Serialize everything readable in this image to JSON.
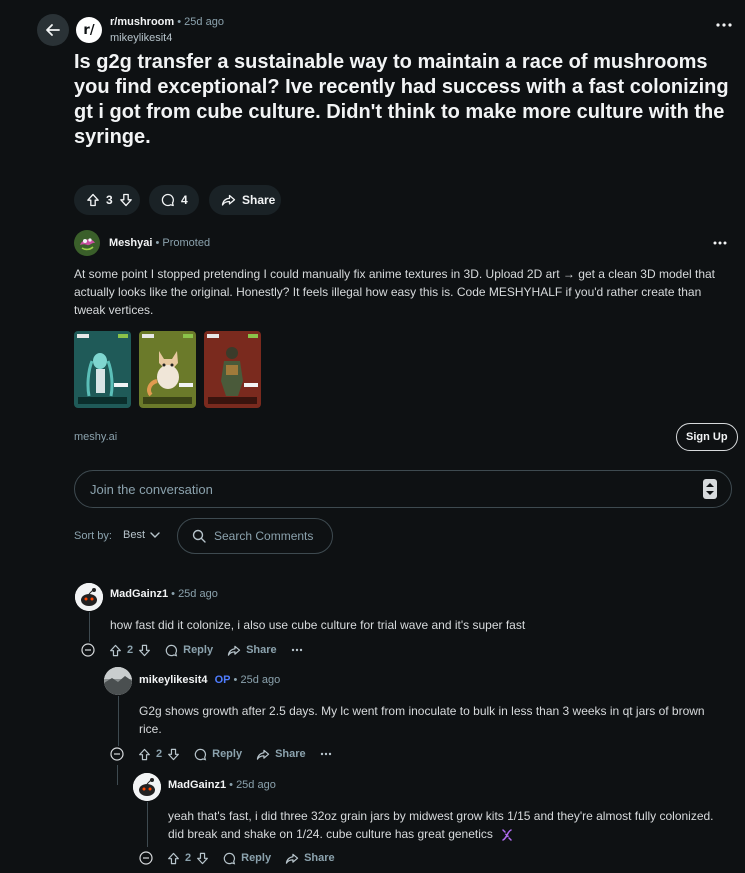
{
  "post": {
    "subreddit": "r/mushroom",
    "subreddit_avatar": "r/",
    "age": "25d ago",
    "author": "mikeylikesit4",
    "title": "Is g2g transfer a sustainable way to maintain a race of mushrooms you find exceptional? Ive recently had success with a fast colonizing gt i got from cube culture. Didn't think to make more culture with the syringe.",
    "votes": "3",
    "comments": "4",
    "share_label": "Share"
  },
  "ad": {
    "advertiser": "Meshyai",
    "promoted": "Promoted",
    "text": "At some point I stopped pretending I could manually fix anime textures in 3D. Upload 2D art → get a clean 3D model that actually looks like the original. Honestly? It feels illegal how easy this is. Code MESHYHALF if you'd rather create than tweak vertices.",
    "domain": "meshy.ai",
    "cta": "Sign Up",
    "thumb_colors": [
      "#1f5a58",
      "#6b7a2a",
      "#7a2a1e"
    ]
  },
  "comments_bar": {
    "join_placeholder": "Join the conversation",
    "sort_label": "Sort by:",
    "sort_value": "Best",
    "search_placeholder": "Search Comments"
  },
  "comment_list": [
    {
      "author": "MadGainz1",
      "op": "",
      "age": "25d ago",
      "text": "how fast did it colonize, i also use cube culture for trial wave and it's super fast",
      "votes": "2",
      "reply": "Reply",
      "share": "Share"
    },
    {
      "author": "mikeylikesit4",
      "op": "OP",
      "age": "25d ago",
      "text": "G2g shows growth after 2.5 days. My lc went from inoculate to bulk in less than 3 weeks in qt jars of brown rice.",
      "votes": "2",
      "reply": "Reply",
      "share": "Share"
    },
    {
      "author": "MadGainz1",
      "op": "",
      "age": "25d ago",
      "text": "yeah that's fast, i did three 32oz grain jars by midwest grow kits 1/15 and they're almost fully colonized. did break and shake on 1/24. cube culture has great genetics",
      "votes": "2",
      "reply": "Reply",
      "share": "Share"
    }
  ],
  "colors": {
    "background": "#0e1113",
    "op_badge": "#4f7dff",
    "text_meta": "#8ba2ad"
  }
}
